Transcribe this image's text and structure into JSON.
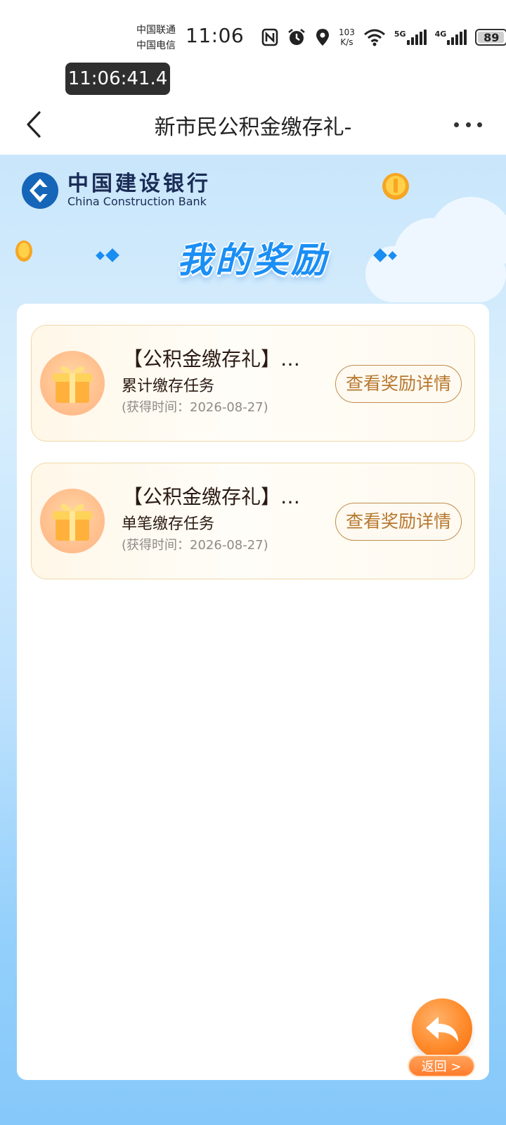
{
  "status_bar": {
    "carrier_1": "中国联通",
    "carrier_2": "中国电信",
    "time": "11:06",
    "net_speed_value": "103",
    "net_speed_unit": "K/s",
    "net_1": "5G",
    "net_2": "4G",
    "battery": "89",
    "battery_level": 0.89,
    "icons": [
      "nfc-icon",
      "alarm-icon",
      "location-icon",
      "wifi-icon",
      "signal-icon",
      "signal-icon",
      "battery-icon"
    ]
  },
  "timestamp_overlay": "11:06:41.4",
  "header": {
    "title": "新市民公积金缴存礼-"
  },
  "bank": {
    "name_cn": "中国建设银行",
    "name_en": "China Construction Bank"
  },
  "section_title": "我的奖励",
  "rewards": [
    {
      "title": "【公积金缴存礼】…",
      "subtitle": "累计缴存任务",
      "time": "(获得时间：2026-08-27)",
      "button": "查看奖励详情"
    },
    {
      "title": "【公积金缴存礼】…",
      "subtitle": "单笔缴存任务",
      "time": "(获得时间：2026-08-27)",
      "button": "查看奖励详情"
    }
  ],
  "return_button": "返回 >",
  "colors": {
    "brand_blue": "#1b8ff5",
    "ccb_navy": "#1a2c56",
    "button_text": "#b6782f",
    "card_border": "#eed9a8"
  }
}
